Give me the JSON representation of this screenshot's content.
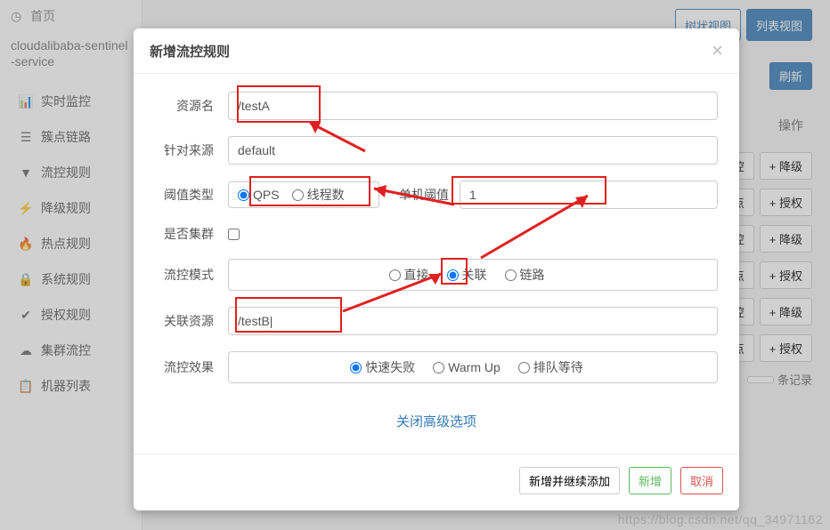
{
  "sidebar": {
    "home": "首页",
    "app": "cloudalibaba-sentinel-service",
    "items": [
      {
        "icon": "📊",
        "label": "实时监控"
      },
      {
        "icon": "☰",
        "label": "簇点链路"
      },
      {
        "icon": "▼",
        "label": "流控规则"
      },
      {
        "icon": "⚡",
        "label": "降级规则"
      },
      {
        "icon": "🔥",
        "label": "热点规则"
      },
      {
        "icon": "🔒",
        "label": "系统规则"
      },
      {
        "icon": "✔",
        "label": "授权规则"
      },
      {
        "icon": "☁",
        "label": "集群流控"
      },
      {
        "icon": "📋",
        "label": "机器列表"
      }
    ]
  },
  "topbar": {
    "tree_view": "树状视图",
    "list_view": "列表视图",
    "refresh": "刷新"
  },
  "bg": {
    "ops_title": "操作",
    "flow_btn": "流控",
    "degrade_btn": "+ 降级",
    "hotspot_btn": "热点",
    "auth_btn": "+ 授权",
    "records": "条记录"
  },
  "modal": {
    "title": "新增流控规则",
    "labels": {
      "resource": "资源名",
      "source": "针对来源",
      "threshold_type": "阈值类型",
      "single_threshold": "单机阈值",
      "is_cluster": "是否集群",
      "mode": "流控模式",
      "related_resource": "关联资源",
      "effect": "流控效果"
    },
    "values": {
      "resource": "/testA",
      "source": "default",
      "single_threshold": "1",
      "related_resource": "/testB|"
    },
    "threshold_type_options": {
      "qps": "QPS",
      "threads": "线程数"
    },
    "threshold_type_selected": "qps",
    "mode_options": {
      "direct": "直接",
      "related": "关联",
      "chain": "链路"
    },
    "mode_selected": "related",
    "effect_options": {
      "fail_fast": "快速失败",
      "warm_up": "Warm Up",
      "queue": "排队等待"
    },
    "effect_selected": "fail_fast",
    "adv_link": "关闭高级选项",
    "footer": {
      "add_continue": "新增并继续添加",
      "add": "新增",
      "cancel": "取消"
    }
  },
  "watermark": "https://blog.csdn.net/qq_34971162"
}
